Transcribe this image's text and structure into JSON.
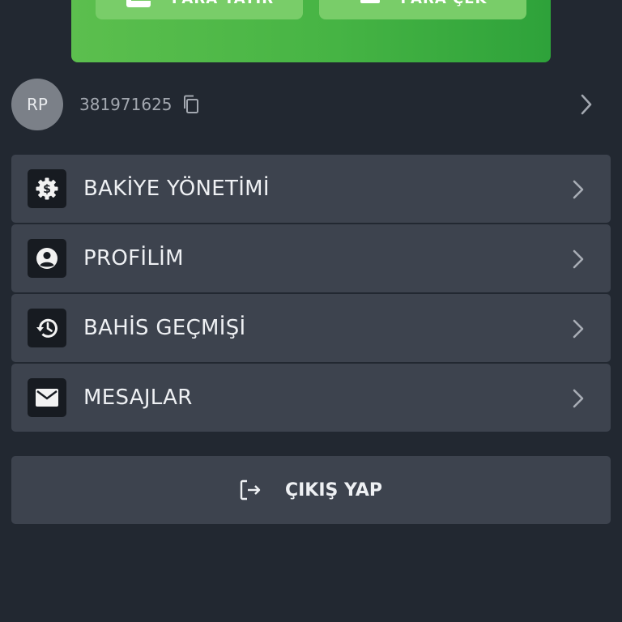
{
  "promo": {
    "buttons": [
      {
        "label": "PARA YATIR",
        "icon": "wallet-icon"
      },
      {
        "label": "PARA ÇEK",
        "icon": "coins-icon"
      }
    ]
  },
  "user": {
    "initials": "RP",
    "id": "381971625"
  },
  "menu": {
    "items": [
      {
        "label": "BAKİYE YÖNETİMİ",
        "icon": "balance-gear-icon"
      },
      {
        "label": "PROFİLİM",
        "icon": "profile-icon"
      },
      {
        "label": "BAHİS GEÇMİŞİ",
        "icon": "history-icon"
      },
      {
        "label": "MESAJLAR",
        "icon": "mail-icon"
      }
    ]
  },
  "logout": {
    "label": "ÇIKIŞ YAP",
    "icon": "logout-icon"
  },
  "colors": {
    "background": "#222831",
    "card": "#3d434e",
    "accent_green": "#46b444",
    "avatar": "#7b8088"
  }
}
